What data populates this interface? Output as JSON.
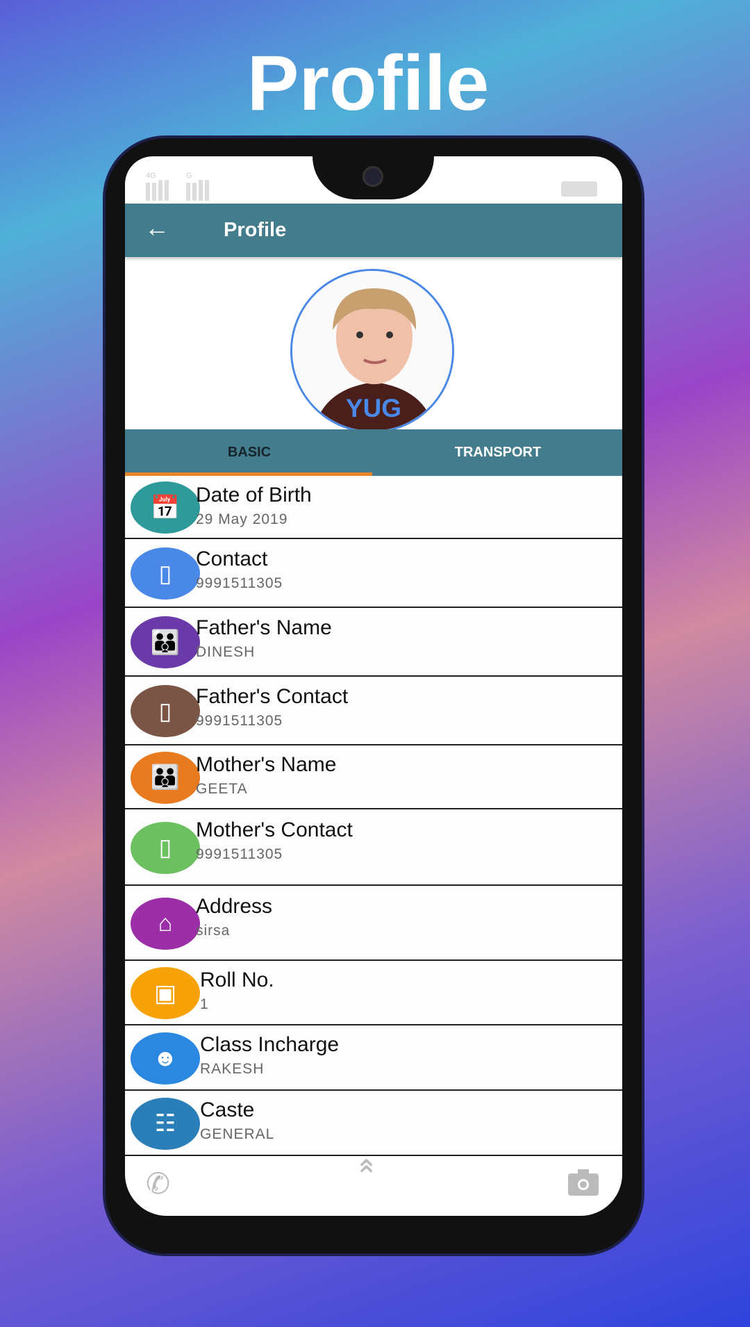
{
  "headline": "Profile",
  "status": {
    "net1": "4G",
    "net2": "G"
  },
  "appbar": {
    "title": "Profile",
    "back_icon": "arrow-left-icon"
  },
  "profile": {
    "name": "YUG",
    "accent": "#4a88e8"
  },
  "tabs": [
    {
      "label": "BASIC",
      "active": true
    },
    {
      "label": "TRANSPORT",
      "active": false
    }
  ],
  "colors": {
    "appbar": "#437c8c",
    "indicator": "#e8862a"
  },
  "fields": [
    {
      "label": "Date of Birth",
      "value": "29 May 2019",
      "icon": "calendar-icon",
      "color": "#2f9a9a"
    },
    {
      "label": "Contact",
      "value": "9991511305",
      "icon": "phone-icon",
      "color": "#4a88e8"
    },
    {
      "label": "Father's Name",
      "value": "DINESH",
      "icon": "family-icon",
      "color": "#6a3aa8"
    },
    {
      "label": "Father's Contact",
      "value": "9991511305",
      "icon": "phone-icon",
      "color": "#7a5546"
    },
    {
      "label": "Mother's Name",
      "value": "GEETA",
      "icon": "family-icon",
      "color": "#e87a20"
    },
    {
      "label": "Mother's Contact",
      "value": "9991511305",
      "icon": "phone-icon",
      "color": "#6cc060"
    },
    {
      "label": "Address",
      "value": "sirsa",
      "icon": "home-icon",
      "color": "#9c2ea8"
    },
    {
      "label": "Roll No.",
      "value": "1",
      "icon": "id-card-icon",
      "color": "#f8a20a"
    },
    {
      "label": "Class Incharge",
      "value": "RAKESH",
      "icon": "teacher-icon",
      "color": "#2a88e0"
    },
    {
      "label": "Caste",
      "value": "GENERAL",
      "icon": "hierarchy-icon",
      "color": "#2a7fb8"
    }
  ],
  "bottom_nav": [
    "phone-icon",
    "chevron-double-up-icon",
    "camera-icon"
  ]
}
